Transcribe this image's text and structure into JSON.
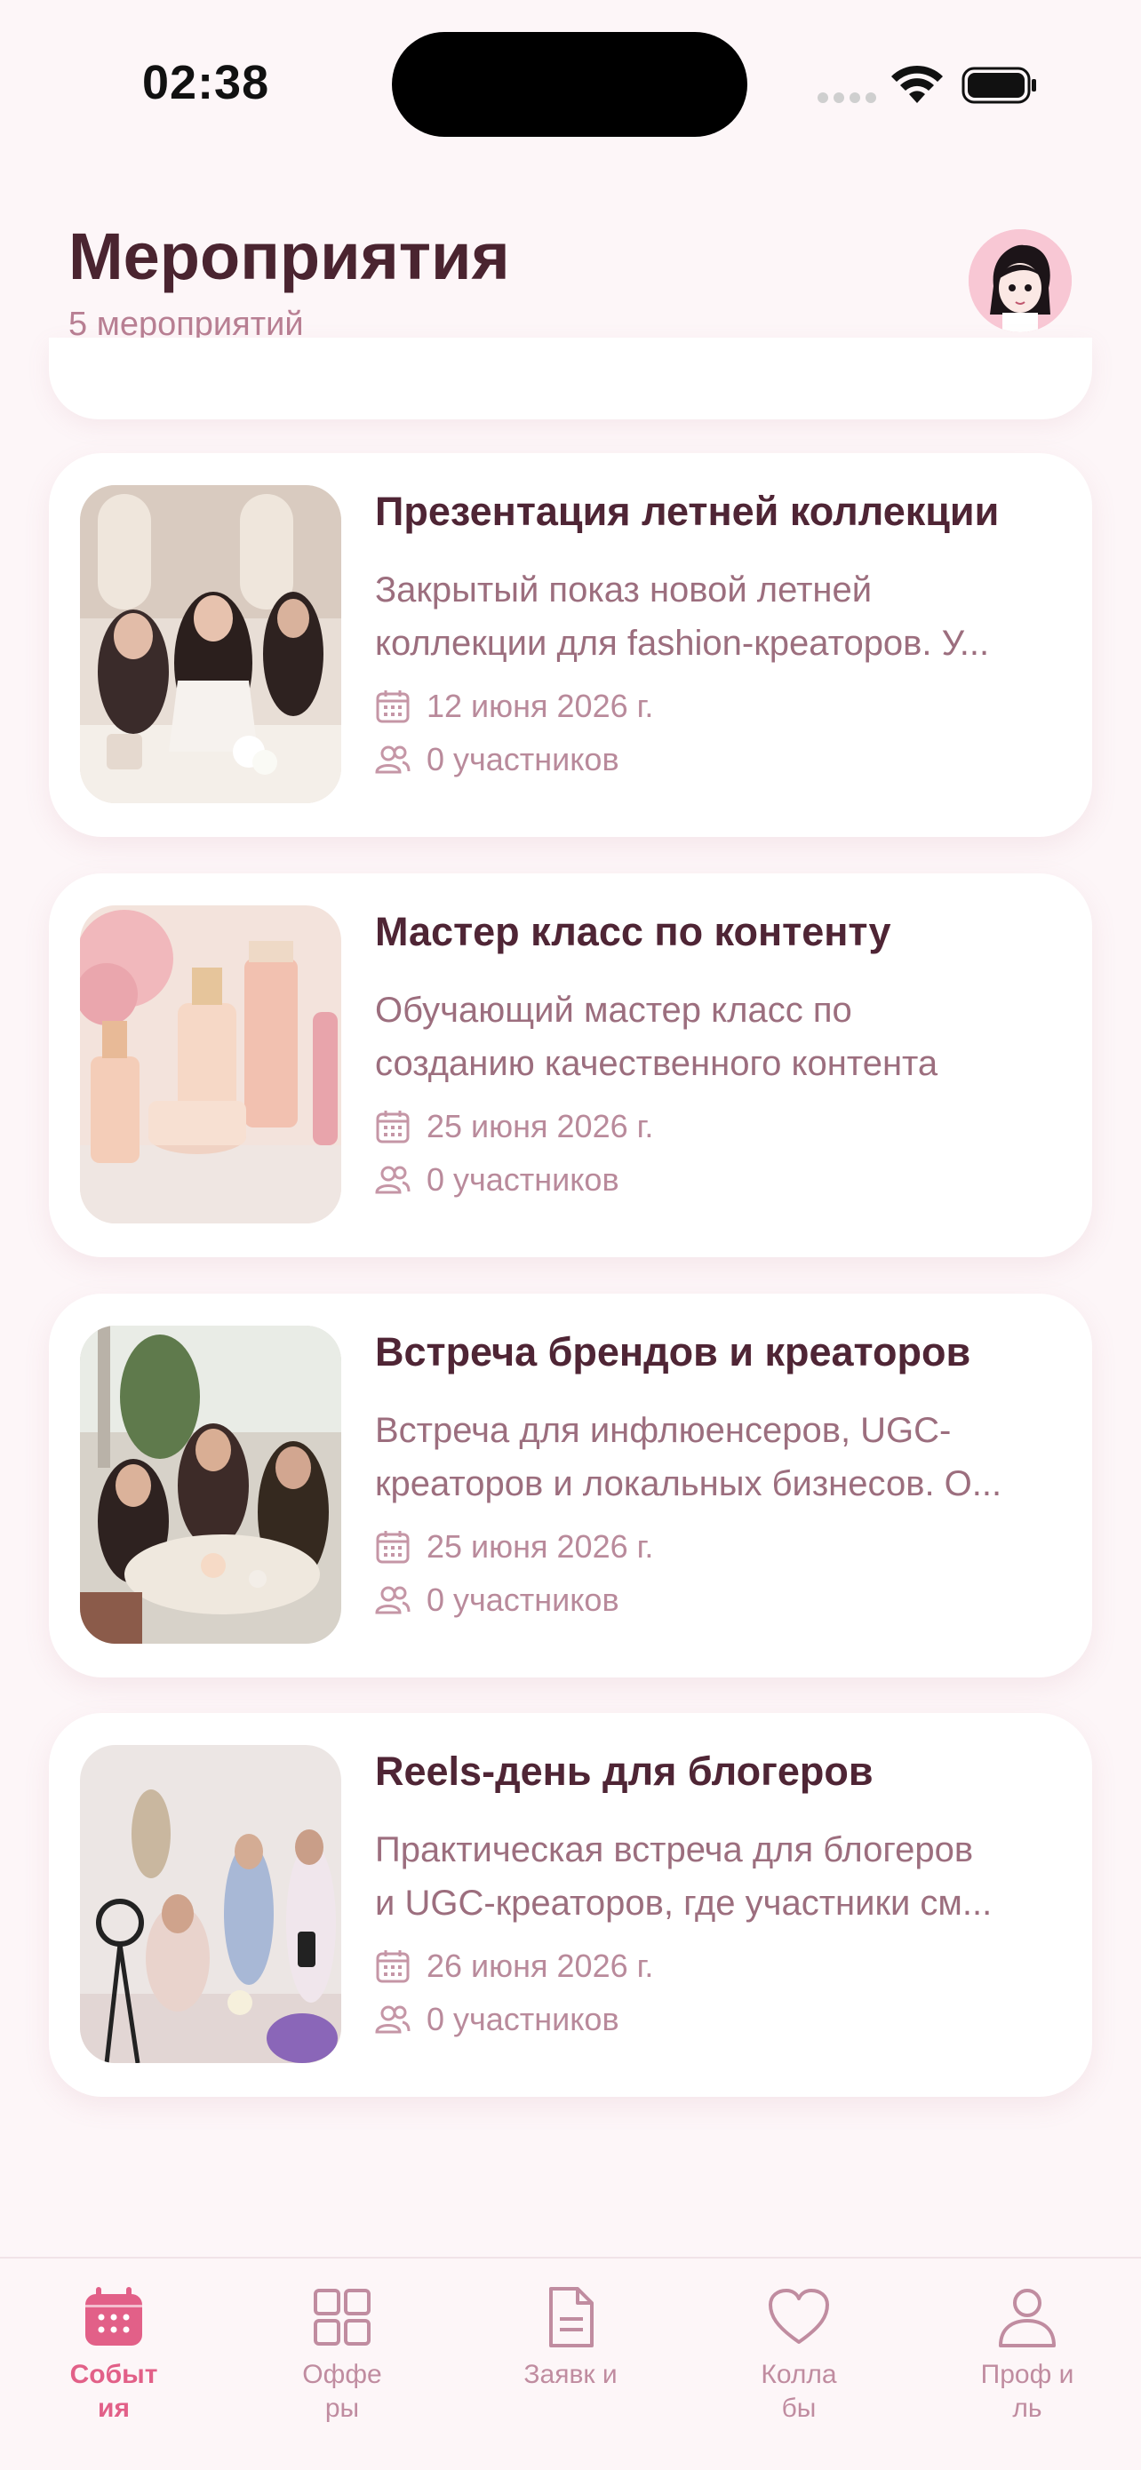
{
  "status_bar": {
    "time": "02:38"
  },
  "header": {
    "title": "Мероприятия",
    "subtitle": "5 мероприятий"
  },
  "events": [
    {
      "title": "Презентация летней коллекции",
      "desc_line1": "Закрытый показ новой летней",
      "desc_line2": "коллекции для fashion-креаторов. У...",
      "date": "12 июня 2026 г.",
      "participants": "0 участников"
    },
    {
      "title": "Мастер класс по контенту",
      "desc_line1": "Обучающий мастер класс по",
      "desc_line2": "созданию качественного контента",
      "date": "25 июня 2026 г.",
      "participants": "0 участников"
    },
    {
      "title": "Встреча брендов и креаторов",
      "desc_line1": "Встреча для инфлюенсеров, UGC-",
      "desc_line2": "креаторов и локальных бизнесов. О...",
      "date": "25 июня 2026 г.",
      "participants": "0 участников"
    },
    {
      "title": "Reels-день для блогеров",
      "desc_line1": "Практическая встреча для блогеров",
      "desc_line2": "и UGC-креаторов, где участники см...",
      "date": "26 июня 2026 г.",
      "participants": "0 участников"
    }
  ],
  "nav": [
    {
      "label": "Событ ия",
      "icon": "calendar-icon",
      "active": true
    },
    {
      "label": "Оффе ры",
      "icon": "grid-icon",
      "active": false
    },
    {
      "label": "Заявк и",
      "icon": "document-icon",
      "active": false
    },
    {
      "label": "Колла бы",
      "icon": "heart-icon",
      "active": false
    },
    {
      "label": "Проф иль",
      "icon": "user-icon",
      "active": false
    }
  ],
  "colors": {
    "accent": "#e26088",
    "inactive": "#c08ca0",
    "title": "#4a2430",
    "background": "#fdf6f8"
  }
}
